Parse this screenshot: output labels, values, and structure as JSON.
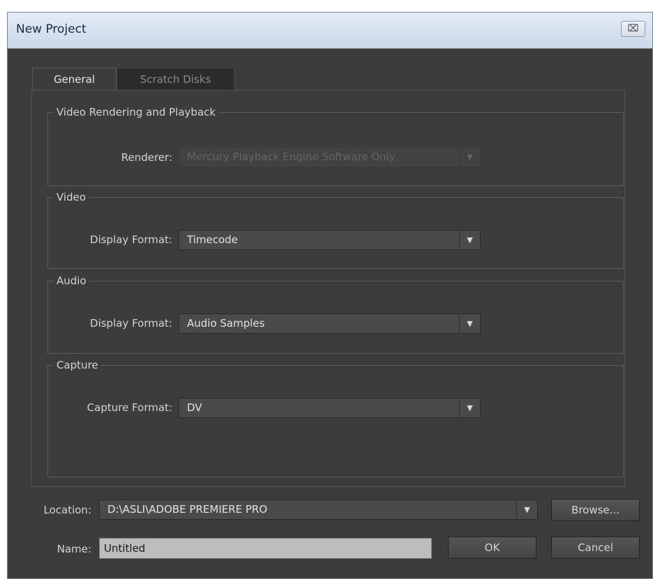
{
  "window": {
    "title": "New Project",
    "close_glyph": "⌧"
  },
  "tabs": [
    {
      "label": "General",
      "active": true
    },
    {
      "label": "Scratch Disks",
      "active": false
    }
  ],
  "sections": {
    "video_rendering": {
      "legend": "Video Rendering and Playback",
      "label": "Renderer:",
      "value": "Mercury Playback Engine Software Only",
      "disabled": true
    },
    "video": {
      "legend": "Video",
      "label": "Display Format:",
      "value": "Timecode"
    },
    "audio": {
      "legend": "Audio",
      "label": "Display Format:",
      "value": "Audio Samples"
    },
    "capture": {
      "legend": "Capture",
      "label": "Capture Format:",
      "value": "DV"
    }
  },
  "location": {
    "label": "Location:",
    "value": "D:\\ASLI\\ADOBE PREMIERE PRO",
    "browse_label": "Browse..."
  },
  "name": {
    "label": "Name:",
    "value": "Untitled"
  },
  "buttons": {
    "ok": "OK",
    "cancel": "Cancel"
  },
  "icons": {
    "dropdown": "chevron-down-icon",
    "close": "close-icon"
  },
  "colors": {
    "dialog_bg": "#3c3c3c",
    "titlebar": "#d6e2f1",
    "text": "#d4d4d4"
  }
}
